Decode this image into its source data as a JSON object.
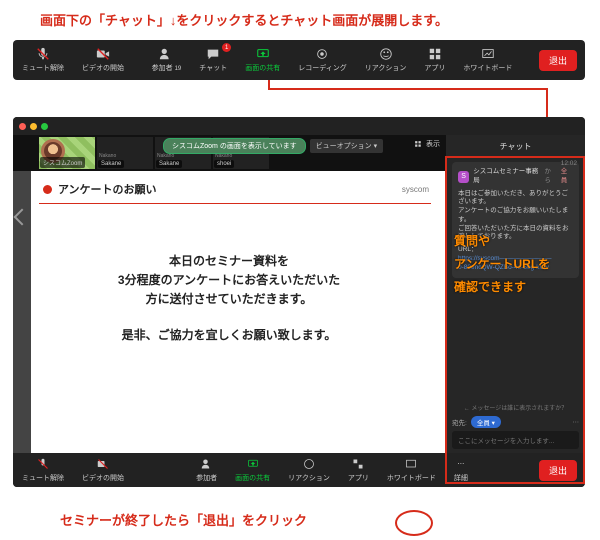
{
  "captions": {
    "top": "画面下の「チャット」↓をクリックするとチャット画面が展開します。",
    "bottom": "セミナーが終了したら「退出」をクリック"
  },
  "toolbar_top": {
    "mute": "ミュート解除",
    "video": "ビデオの開始",
    "participants": "参加者",
    "participants_count": "19",
    "chat": "チャット",
    "chat_badge": "1",
    "share": "画面の共有",
    "record": "レコーディング",
    "reaction": "リアクション",
    "apps": "アプリ",
    "whiteboard": "ホワイトボード",
    "exit": "退出"
  },
  "share_pill": "シスコムZoom の画面を表示しています",
  "view_pill": "ビューオプション ▾",
  "view_toggle": "表示",
  "thumbs": [
    {
      "name": "シスコムZoom"
    },
    {
      "name": "Sakane"
    },
    {
      "name": "Sakane"
    },
    {
      "name": "shoei"
    }
  ],
  "thumb_sub": "Nakano",
  "slide": {
    "title": "アンケートのお願い",
    "brand": "syscom",
    "line1": "本日のセミナー資料を",
    "line2": "3分程度のアンケートにお答えいただいた",
    "line3": "方に送付させていただきます。",
    "line4": "是非、ご協力を宜しくお願い致します。"
  },
  "chat": {
    "header": "チャット",
    "from_name": "シスコムセミナー事務局",
    "from_sep": "から",
    "to_all": "全員",
    "time": "12:02",
    "body1": "本日はご参加いただき、ありがとうございます。",
    "body2": "アンケートのご協力をお願いいたします。",
    "body3": "ご回答いただいた方に本日の資料をお渡ししております。",
    "url_label": "URL：",
    "url1": "https://syscom————————",
    "url2": "0-80encQW-QZBo-4e-80g-kWv",
    "note_l1": "質問や",
    "note_l2": "アンケートURLを",
    "note_l3": "確認できます",
    "hint": "← メッセージは誰に表示されますか？",
    "to_label": "宛先:",
    "to_value": "全員 ▾",
    "input_placeholder": "ここにメッセージを入力します..."
  },
  "toolbar_bottom": {
    "mute": "ミュート解除",
    "video": "ビデオの開始",
    "participants": "参加者",
    "share": "画面の共有",
    "reaction": "リアクション",
    "apps": "アプリ",
    "whiteboard": "ホワイトボード",
    "more": "詳細",
    "exit": "退出"
  }
}
